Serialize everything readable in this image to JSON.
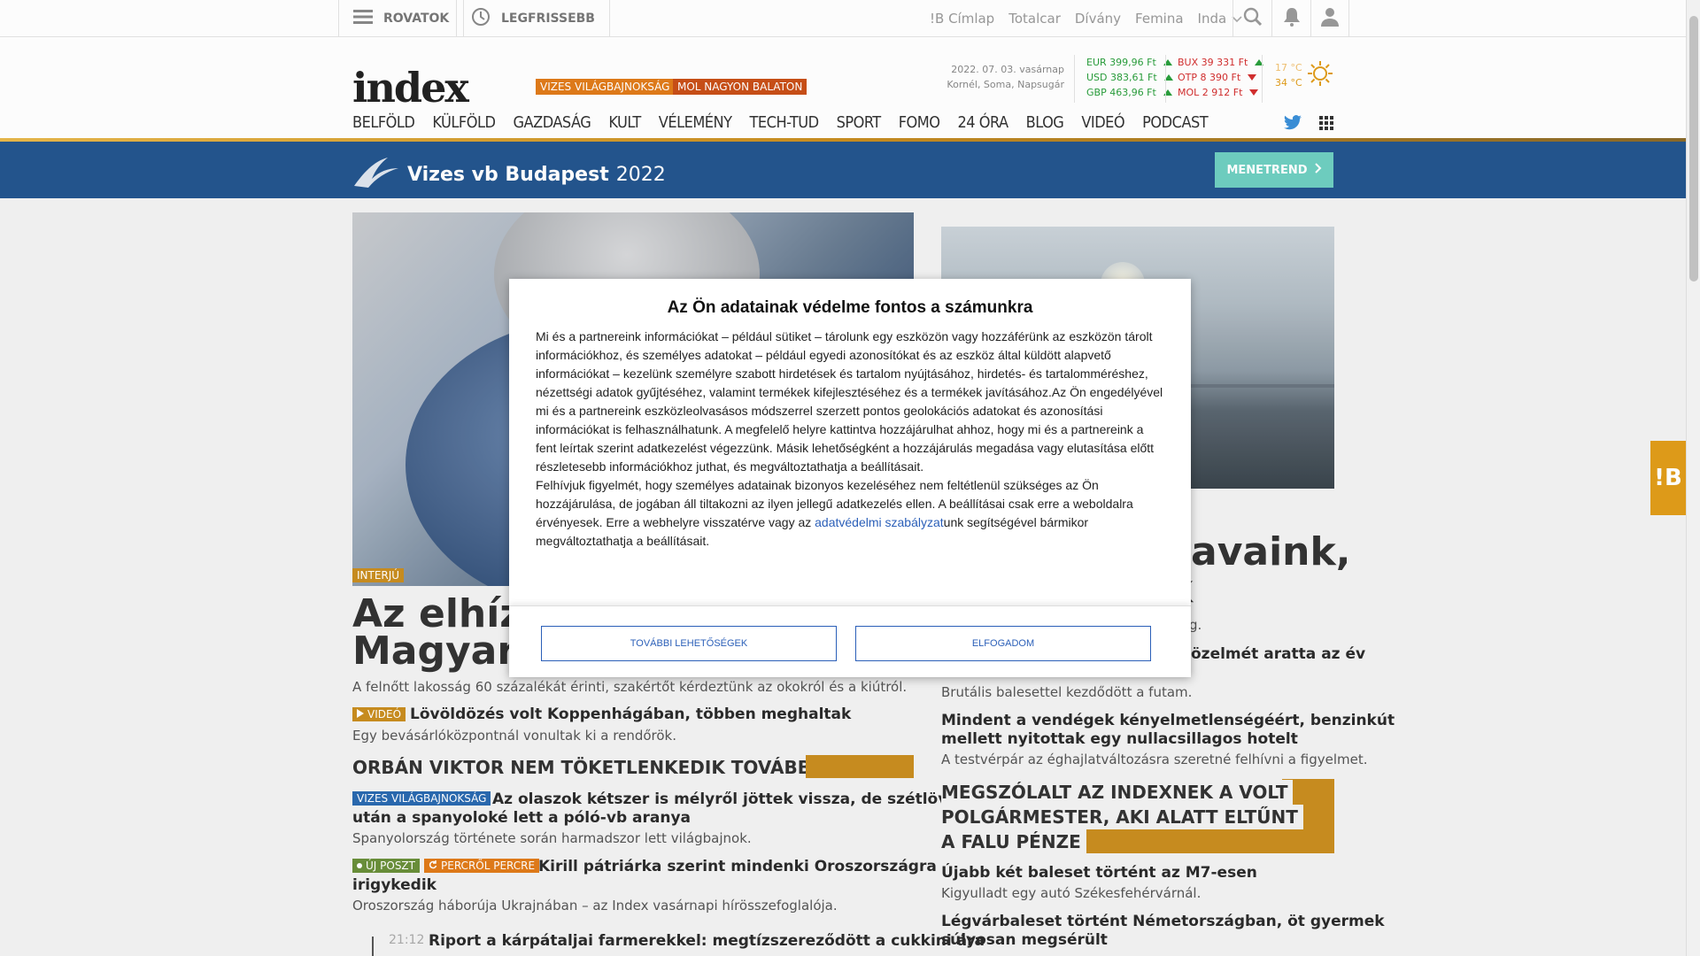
{
  "topbar": {
    "rovatok": "ROVATOK",
    "legfrissebb": "LEGFRISSEBB",
    "links": [
      "!B Címlap",
      "Totalcar",
      "Dívány",
      "Femina",
      "Inda"
    ]
  },
  "header": {
    "logo": "index",
    "tags": [
      "VIZES VILÁGBAJNOKSÁG",
      "MOL NAGYON BALATON"
    ],
    "date": "2022. 07. 03. vasárnap",
    "namedays": "Kornél, Soma, Napsugár",
    "rates_left": [
      "EUR 399,96 Ft",
      "USD 383,61 Ft",
      "GBP 463,96 Ft"
    ],
    "rates_right": [
      "BUX 39 331 Ft",
      "OTP 8 390 Ft",
      "MOL 2 912 Ft"
    ],
    "weather_min": "17 °C",
    "weather_max": "34 °C",
    "nav": [
      "BELFÖLD",
      "KÜLFÖLD",
      "GAZDASÁG",
      "KULT",
      "VÉLEMÉNY",
      "TECH-TUD",
      "SPORT",
      "FOMO",
      "24 ÓRA",
      "BLOG",
      "VIDEÓ",
      "PODCAST"
    ]
  },
  "banner": {
    "title": "Vizes vb Budapest",
    "year": "2022",
    "button": "MENETREND"
  },
  "main": {
    "interview_tag": "INTERJÚ",
    "headline_line1": "Az elhízás",
    "headline_line2": "Magyaron",
    "lead": "A felnőtt lakosság 60 százalékát érinti, szakértőt kérdeztünk az okokról és a kiútról.",
    "video_tag": "VIDEÓ",
    "a1_title": "Lövöldözés volt Koppenhágában, többen meghaltak",
    "a1_lead": "Egy bevásárlóközpontnál vonultak ki a rendőrök.",
    "orban_caption": "ORBÁN VIKTOR NEM TÖKETLENKEDIK TOVÁBB",
    "vb_tag": "VIZES VILÁGBAJNOKSÁG",
    "a2_title_1": "Az olaszok kétszer is mélyről jöttek vissza, de szétlövés",
    "a2_title_2": "után a spanyoloké lett a póló-vb aranya",
    "a2_lead": "Spanyolország története során harmadszor lett világbajnok.",
    "new_post_tag": "ÚJ POSZT",
    "live_tag": "PERCRŐL PERCRE",
    "a3_title_1": "Kirill pátriárka szerint mindenki Oroszországra",
    "a3_title_2": "irigykedik",
    "a3_lead": "Oroszország háborúja Ukrajnában – az Index vasárnapi hírösszefoglalója.",
    "timeline_time": "21:12",
    "timeline_title": "Riport a kárpátaljai farmerekkel: megtízszereződött a cukkini ára"
  },
  "right": {
    "headline_line1": "avaink,",
    "headline_line2": "k",
    "r_sub": "g.",
    "r1_title_end": "özelmét aratta az év",
    "r1_lead": "Brutális balesettel kezdődött a futam.",
    "r2_title_1": "Mindent a vendégek kényelmetlenségéért, benzinkút",
    "r2_title_2": "mellett nyitottak egy nullacsillagos hotelt",
    "r2_lead": "A testvérpár az éghajlatváltozásra szeretné felhívni a figyelmet.",
    "caption_1": "MEGSZÓLALT AZ INDEXNEK A VOLT",
    "caption_2": "POLGÁRMESTER, AKI ALATT ELTŰNT",
    "caption_3": "A FALU PÉNZE",
    "r3_title": "Újabb két baleset történt az M7-esen",
    "r3_lead": "Kigyulladt egy autó Székesfehérvárnál.",
    "r4_title_1": "Légvárbaleset történt Németországban, öt gyermek",
    "r4_title_2": "súlyosan megsérült"
  },
  "ib_tab": "!B",
  "modal": {
    "title": "Az Ön adatainak védelme fontos a számunkra",
    "p1": "Mi és a partnereink információkat – például sütiket – tárolunk egy eszközön vagy hozzáférünk az eszközön tárolt információkhoz, és személyes adatokat – például egyedi azonosítókat és az eszköz által küldött alapvető információkat – kezelünk személyre szabott hirdetések és tartalom nyújtásához, hirdetés- és tartalomméréshez, nézettségi adatok gyűjtéséhez, valamint termékek kifejlesztéséhez és a termékek javításához.Az Ön engedélyével mi és a partnereink eszközleolvasásos módszerrel szerzett pontos geolokációs adatokat és azonosítási információkat is felhasználhatunk. A megfelelő helyre kattintva hozzájárulhat ahhoz, hogy mi és a partnereink a fent leírtak szerint adatkezelést végezzünk. Másik lehetőségként a hozzájárulás megadása vagy elutasítása előtt részletesebb információkhoz juthat, és megváltoztathatja a beállításait.",
    "p2_pre": "Felhívjuk figyelmét, hogy személyes adatainak bizonyos kezeléséhez nem feltétlenül szükséges az Ön hozzájárulása, de jogában áll tiltakozni az ilyen jellegű adatkezelés ellen. A beállításai csak erre a weboldalra érvényesek. Erre a webhelyre visszatérve vagy az ",
    "p2_link": "adatvédelmi szabályzat",
    "p2_post": "unk segítségével bármikor megváltoztathatja a beállításait.",
    "btn_more": "TOVÁBBI LEHETŐSÉGEK",
    "btn_accept": "ELFOGADOM"
  },
  "colors": {
    "accent": "#e09c1a",
    "vb_blue": "#24558e",
    "tag_orange": "#e07b1a",
    "modal_link": "#2b5fb8"
  }
}
